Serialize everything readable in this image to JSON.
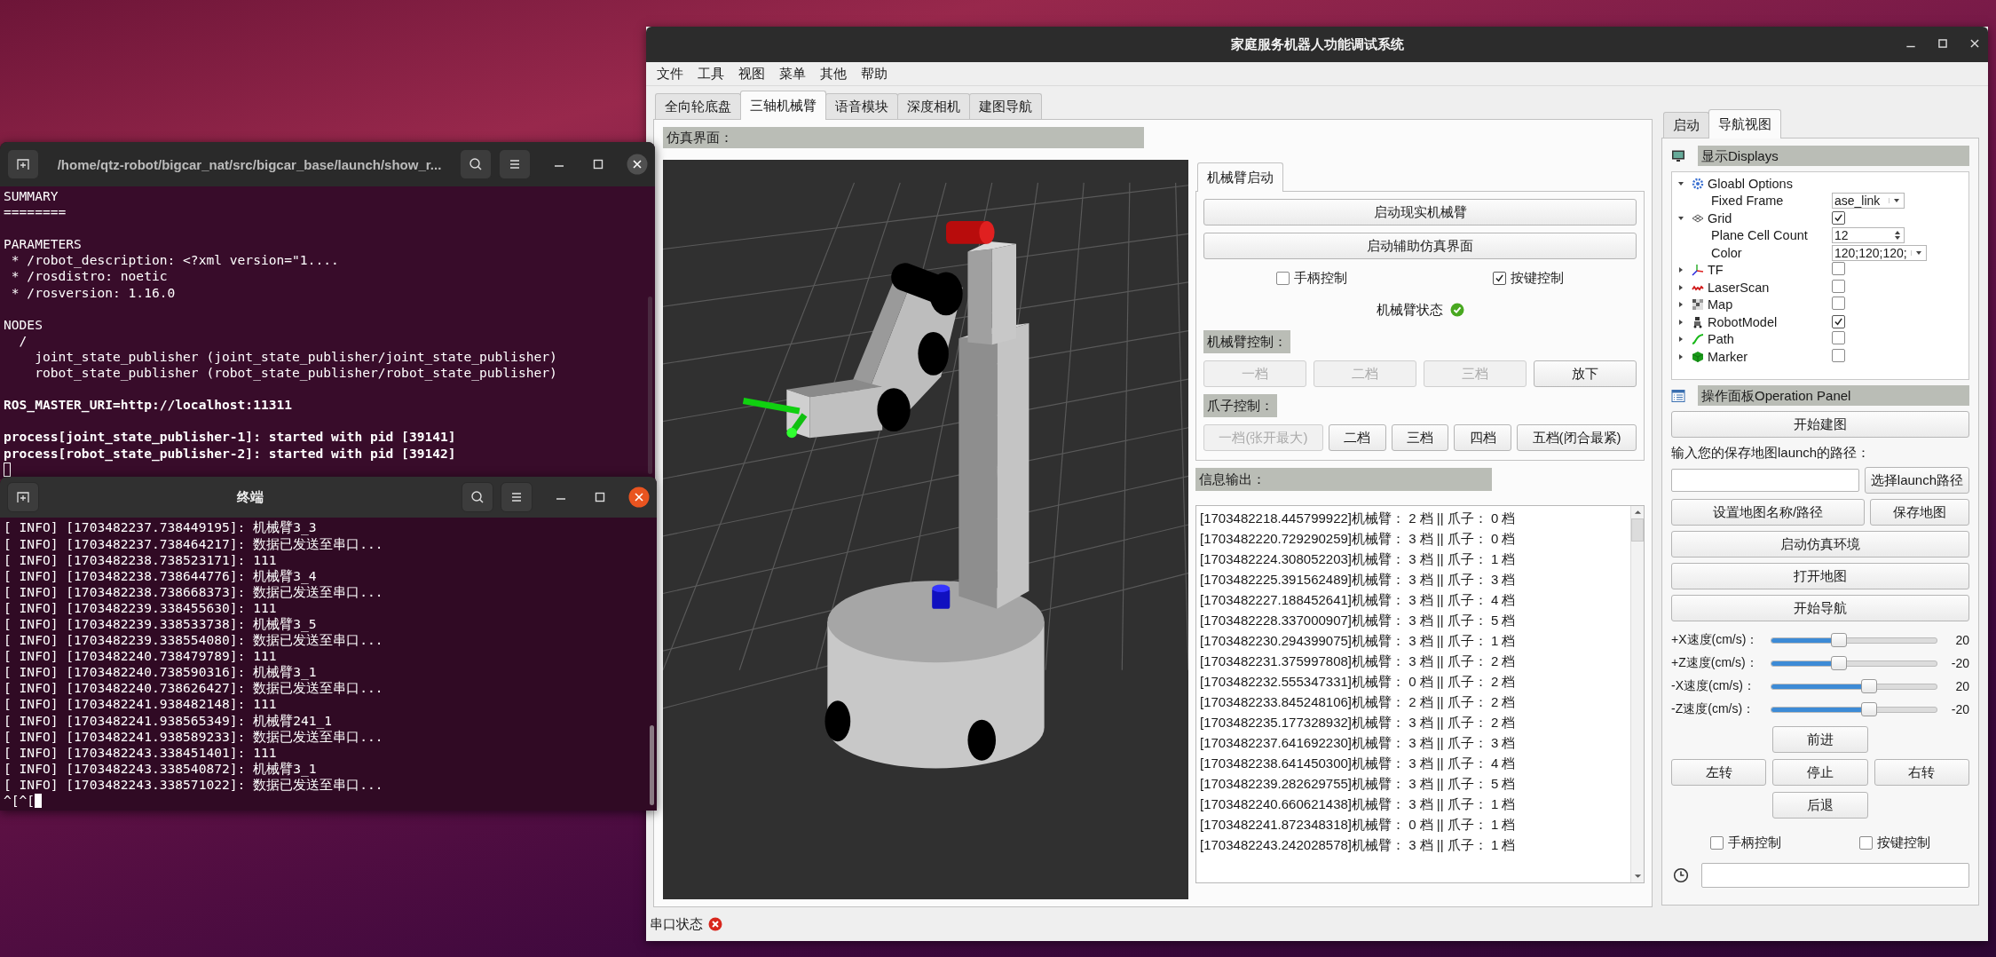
{
  "terminals": [
    {
      "title": "/home/qtz-robot/bigcar_nat/src/bigcar_base/launch/show_r...",
      "focused": false,
      "lines": [
        {
          "text": "SUMMARY",
          "bold": false,
          "gap_before": false
        },
        {
          "text": "========",
          "bold": false,
          "gap_before": false
        },
        {
          "text": "PARAMETERS",
          "bold": false,
          "gap_before": true
        },
        {
          "text": " * /robot_description: <?xml version=\"1....",
          "bold": false,
          "gap_before": false
        },
        {
          "text": " * /rosdistro: noetic",
          "bold": false,
          "gap_before": false
        },
        {
          "text": " * /rosversion: 1.16.0",
          "bold": false,
          "gap_before": false
        },
        {
          "text": "NODES",
          "bold": false,
          "gap_before": true
        },
        {
          "text": "  /",
          "bold": false,
          "gap_before": false
        },
        {
          "text": "    joint_state_publisher (joint_state_publisher/joint_state_publisher)",
          "bold": false,
          "gap_before": false
        },
        {
          "text": "    robot_state_publisher (robot_state_publisher/robot_state_publisher)",
          "bold": false,
          "gap_before": false
        },
        {
          "text": "ROS_MASTER_URI=http://localhost:11311",
          "bold": true,
          "gap_before": true
        },
        {
          "text": "process[joint_state_publisher-1]: started with pid [39141]",
          "bold": true,
          "gap_before": true
        },
        {
          "text": "process[robot_state_publisher-2]: started with pid [39142]",
          "bold": true,
          "gap_before": false
        }
      ]
    },
    {
      "title": "终端",
      "focused": true,
      "prompt": "^[^[",
      "lines": [
        {
          "text": "[ INFO] [1703482237.738449195]: 机械臂3_3",
          "bold": false,
          "gap_before": false
        },
        {
          "text": "[ INFO] [1703482237.738464217]: 数据已发送至串口...",
          "bold": false,
          "gap_before": false
        },
        {
          "text": "[ INFO] [1703482238.738523171]: 111",
          "bold": false,
          "gap_before": false
        },
        {
          "text": "[ INFO] [1703482238.738644776]: 机械臂3_4",
          "bold": false,
          "gap_before": false
        },
        {
          "text": "[ INFO] [1703482238.738668373]: 数据已发送至串口...",
          "bold": false,
          "gap_before": false
        },
        {
          "text": "[ INFO] [1703482239.338455630]: 111",
          "bold": false,
          "gap_before": false
        },
        {
          "text": "[ INFO] [1703482239.338533738]: 机械臂3_5",
          "bold": false,
          "gap_before": false
        },
        {
          "text": "[ INFO] [1703482239.338554080]: 数据已发送至串口...",
          "bold": false,
          "gap_before": false
        },
        {
          "text": "[ INFO] [1703482240.738479789]: 111",
          "bold": false,
          "gap_before": false
        },
        {
          "text": "[ INFO] [1703482240.738590316]: 机械臂3_1",
          "bold": false,
          "gap_before": false
        },
        {
          "text": "[ INFO] [1703482240.738626427]: 数据已发送至串口...",
          "bold": false,
          "gap_before": false
        },
        {
          "text": "[ INFO] [1703482241.938482148]: 111",
          "bold": false,
          "gap_before": false
        },
        {
          "text": "[ INFO] [1703482241.938565349]: 机械臂241_1",
          "bold": false,
          "gap_before": false
        },
        {
          "text": "[ INFO] [1703482241.938589233]: 数据已发送至串口...",
          "bold": false,
          "gap_before": false
        },
        {
          "text": "[ INFO] [1703482243.338451401]: 111",
          "bold": false,
          "gap_before": false
        },
        {
          "text": "[ INFO] [1703482243.338540872]: 机械臂3_1",
          "bold": false,
          "gap_before": false
        },
        {
          "text": "[ INFO] [1703482243.338571022]: 数据已发送至串口...",
          "bold": false,
          "gap_before": false
        }
      ]
    }
  ],
  "app": {
    "title": "家庭服务机器人功能调试系统",
    "menu": [
      "文件",
      "工具",
      "视图",
      "菜单",
      "其他",
      "帮助"
    ],
    "tabs": [
      {
        "label": "全向轮底盘",
        "selected": false
      },
      {
        "label": "三轴机械臂",
        "selected": true
      },
      {
        "label": "语音模块",
        "selected": false
      },
      {
        "label": "深度相机",
        "selected": false
      },
      {
        "label": "建图导航",
        "selected": false
      }
    ],
    "sim_label": "仿真界面：",
    "arm_panel": {
      "tabs": [
        {
          "label": "机械臂启动",
          "selected": true
        }
      ],
      "buttons": [
        "启动现实机械臂",
        "启动辅助仿真界面"
      ],
      "checkboxes": [
        {
          "label": "手柄控制",
          "checked": false
        },
        {
          "label": "按键控制",
          "checked": true
        }
      ],
      "status": {
        "label": "机械臂状态",
        "ok": true
      },
      "arm_control": {
        "label": "机械臂控制：",
        "buttons": [
          {
            "label": "一档",
            "disabled": true
          },
          {
            "label": "二档",
            "disabled": true
          },
          {
            "label": "三档",
            "disabled": true
          },
          {
            "label": "放下",
            "disabled": false
          }
        ]
      },
      "gripper_control": {
        "label": "爪子控制：",
        "buttons": [
          {
            "label": "一档(张开最大)",
            "disabled": true
          },
          {
            "label": "二档",
            "disabled": false
          },
          {
            "label": "三档",
            "disabled": false
          },
          {
            "label": "四档",
            "disabled": false
          },
          {
            "label": "五档(闭合最紧)",
            "disabled": false
          }
        ]
      }
    },
    "info_output": {
      "label": "信息输出：",
      "lines": [
        "[1703482218.445799922]机械臂： 2 档 || 爪子： 0 档",
        "[1703482220.729290259]机械臂： 3 档 || 爪子： 0 档",
        "[1703482224.308052203]机械臂： 3 档 || 爪子： 1 档",
        "[1703482225.391562489]机械臂： 3 档 || 爪子： 3 档",
        "[1703482227.188452641]机械臂： 3 档 || 爪子： 4 档",
        "[1703482228.337000907]机械臂： 3 档 || 爪子： 5 档",
        "[1703482230.294399075]机械臂： 3 档 || 爪子： 1 档",
        "[1703482231.375997808]机械臂： 3 档 || 爪子： 2 档",
        "[1703482232.555347331]机械臂： 0 档 || 爪子： 2 档",
        "[1703482233.845248106]机械臂： 2 档 || 爪子： 2 档",
        "[1703482235.177328932]机械臂： 3 档 || 爪子： 2 档",
        "[1703482237.641692230]机械臂： 3 档 || 爪子： 3 档",
        "[1703482238.641450300]机械臂： 3 档 || 爪子： 4 档",
        "[1703482239.282629755]机械臂： 3 档 || 爪子： 5 档",
        "[1703482240.660621438]机械臂： 3 档 || 爪子： 1 档",
        "[1703482241.872348318]机械臂： 0 档 || 爪子： 1 档",
        "[1703482243.242028578]机械臂： 3 档 || 爪子： 1 档"
      ]
    },
    "side_panel": {
      "tabs": [
        {
          "label": "启动",
          "selected": false
        },
        {
          "label": "导航视图",
          "selected": true
        }
      ],
      "displays": {
        "title": "显示Displays",
        "items": [
          {
            "kind": "options",
            "label": "Gloabl Options",
            "expanded": true,
            "children": [
              {
                "kind": "dropdown",
                "label": "Fixed Frame",
                "value": "ase_link"
              }
            ]
          },
          {
            "kind": "display",
            "label": "Grid",
            "expanded": true,
            "checked": true,
            "children": [
              {
                "kind": "spin",
                "label": "Plane Cell Count",
                "value": "12"
              },
              {
                "kind": "dropdown",
                "label": "Color",
                "value": "120;120;120;"
              }
            ]
          },
          {
            "kind": "display",
            "label": "TF",
            "expanded": false,
            "checked": false
          },
          {
            "kind": "display",
            "label": "LaserScan",
            "expanded": false,
            "checked": false
          },
          {
            "kind": "display",
            "label": "Map",
            "expanded": false,
            "checked": false
          },
          {
            "kind": "display",
            "label": "RobotModel",
            "expanded": false,
            "checked": true
          },
          {
            "kind": "display",
            "label": "Path",
            "expanded": false,
            "checked": false
          },
          {
            "kind": "display",
            "label": "Marker",
            "expanded": false,
            "checked": false
          }
        ]
      },
      "operation": {
        "title": "操作面板Operation Panel",
        "start_button": "开始建图",
        "path_prompt": "输入您的保存地图launch的路径：",
        "browse_button": "选择launch路径",
        "map_buttons": [
          "设置地图名称/路径",
          "保存地图"
        ],
        "buttons": [
          "启动仿真环境",
          "打开地图",
          "开始导航"
        ],
        "sliders": [
          {
            "label": "+X速度(cm/s)：",
            "level": 0.41,
            "reading": "20"
          },
          {
            "label": "+Z速度(cm/s)：",
            "level": 0.41,
            "reading": "-20"
          },
          {
            "label": "-X速度(cm/s)：",
            "level": 0.59,
            "reading": "20"
          },
          {
            "label": "-Z速度(cm/s)：",
            "level": 0.59,
            "reading": "-20"
          }
        ],
        "drive": {
          "forward": "前进",
          "left": "左转",
          "stop": "停止",
          "right": "右转",
          "back": "后退"
        },
        "checkboxes": [
          {
            "label": "手柄控制",
            "checked": false
          },
          {
            "label": "按键控制",
            "checked": false
          }
        ]
      }
    },
    "status_bar": {
      "label": "串口状态",
      "ok": false
    }
  }
}
